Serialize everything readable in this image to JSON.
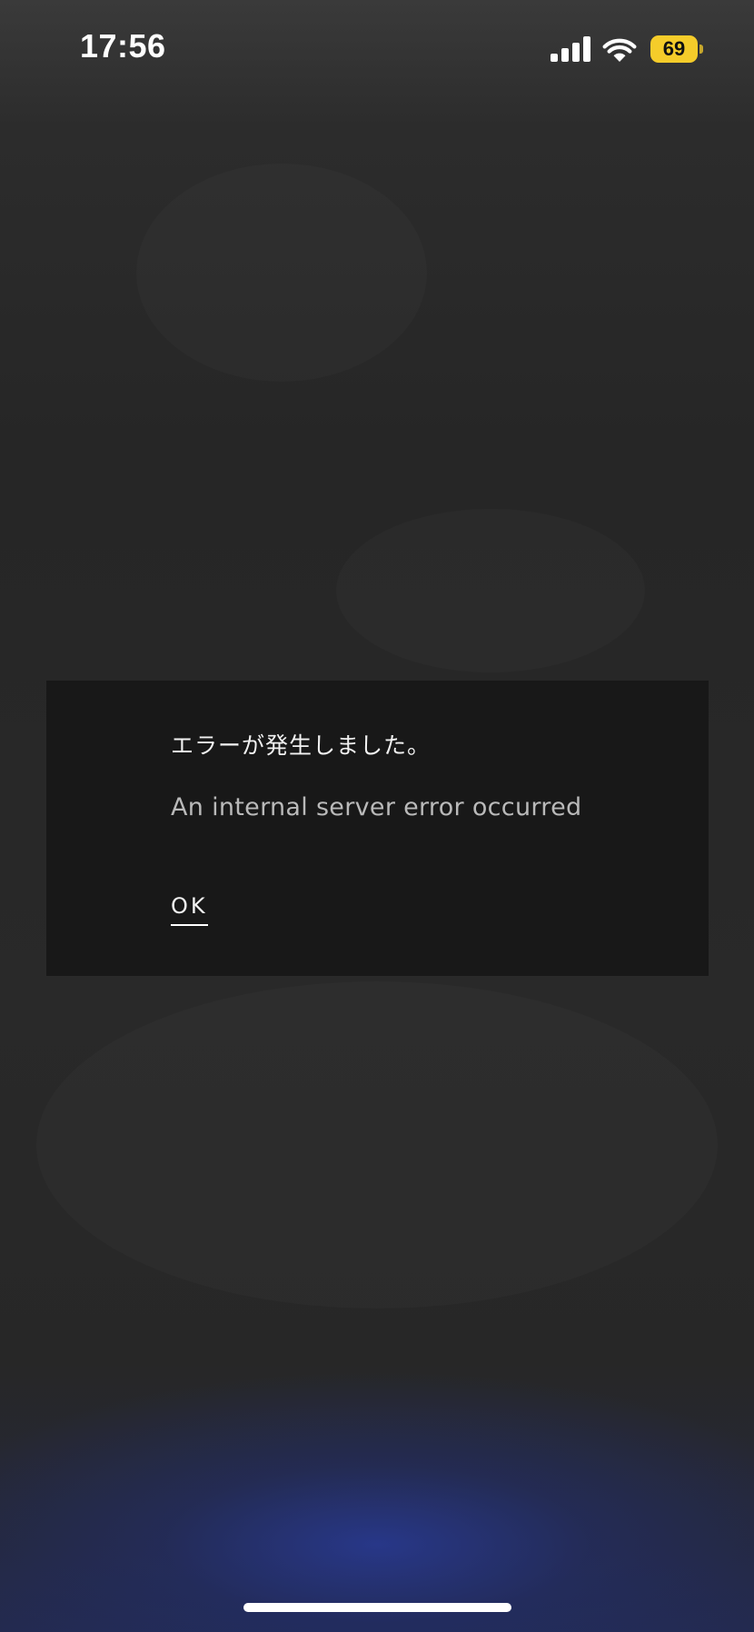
{
  "status_bar": {
    "time": "17:56",
    "battery_level": "69",
    "battery_color": "#f5cc2a",
    "signal_icon": "cellular-signal-icon",
    "wifi_icon": "wifi-icon",
    "battery_icon": "battery-icon"
  },
  "dialog": {
    "title": "エラーが発生しました。",
    "message": "An internal server error occurred",
    "ok_label": "OK"
  },
  "colors": {
    "dialog_background": "#181818",
    "bottom_glow": "#28399a"
  }
}
